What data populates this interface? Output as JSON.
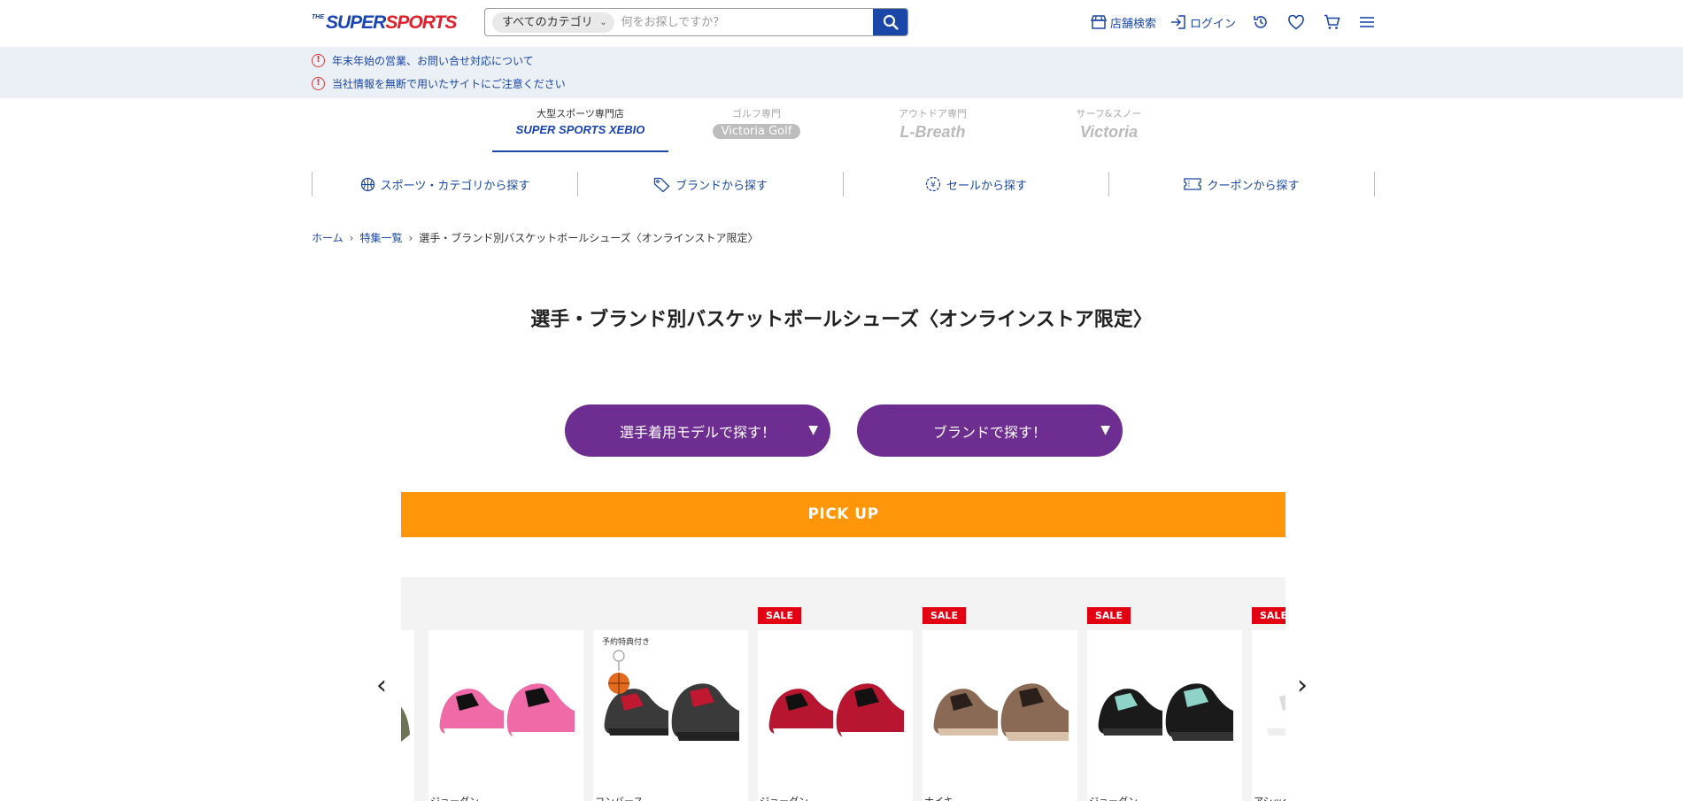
{
  "header": {
    "logo_the": "THE",
    "logo_super": "SUPER",
    "logo_sports": "SPORTS",
    "search": {
      "category": "すべてのカテゴリ",
      "placeholder": "何をお探しですか？"
    },
    "nav": {
      "store_search": "店舗検索",
      "login": "ログイン"
    }
  },
  "notices": [
    "年末年始の営業、お問い合せ対応について",
    "当社情報を無断で用いたサイトにご注意ください"
  ],
  "store_tabs": [
    {
      "sub": "大型スポーツ専門店",
      "brand": "SUPER SPORTS XEBIO"
    },
    {
      "sub": "ゴルフ専門",
      "brand": "Victoria Golf"
    },
    {
      "sub": "アウトドア専門",
      "brand": "L-Breath"
    },
    {
      "sub": "サーフ&スノー",
      "brand": "Victoria"
    }
  ],
  "category_nav": [
    {
      "label": "スポーツ・カテゴリから探す",
      "icon": "basketball-icon"
    },
    {
      "label": "ブランドから探す",
      "icon": "tag-icon"
    },
    {
      "label": "セールから探す",
      "icon": "yen-coin-icon"
    },
    {
      "label": "クーポンから探す",
      "icon": "ticket-icon"
    }
  ],
  "breadcrumb": {
    "home": "ホーム",
    "features": "特集一覧",
    "current": "選手・ブランド別バスケットボールシューズ〈オンラインストア限定〉"
  },
  "page_title": "選手・ブランド別バスケットボールシューズ〈オンラインストア限定〉",
  "buttons": {
    "player_models": "選手着用モデルで探す！",
    "brands": "ブランドで探す！",
    "caret": "▼"
  },
  "pickup_label": "PICK UP",
  "carousel": {
    "prev": "‹",
    "next": "›",
    "sale_label": "SALE",
    "promo_label": "予約特典付き",
    "products": [
      {
        "brand": "ジョーダン",
        "sale": false,
        "colors": [
          "#f06aa8",
          "#111111",
          "#ffffff"
        ]
      },
      {
        "brand": "コンバース",
        "sale": false,
        "colors": [
          "#3a3a3a",
          "#c01830",
          "#222222"
        ]
      },
      {
        "brand": "ジョーダン",
        "sale": true,
        "colors": [
          "#b81530",
          "#111111",
          "#ffffff"
        ]
      },
      {
        "brand": "ナイキ",
        "sale": true,
        "colors": [
          "#8a6a55",
          "#2a1f1a",
          "#d9c0a8"
        ]
      },
      {
        "brand": "ジョーダン",
        "sale": true,
        "colors": [
          "#1a1a1a",
          "#8fd3c8",
          "#333333"
        ]
      },
      {
        "brand": "アシック",
        "sale": true,
        "colors": [
          "#ffffff",
          "#dddddd",
          "#eeeeee"
        ]
      }
    ]
  }
}
